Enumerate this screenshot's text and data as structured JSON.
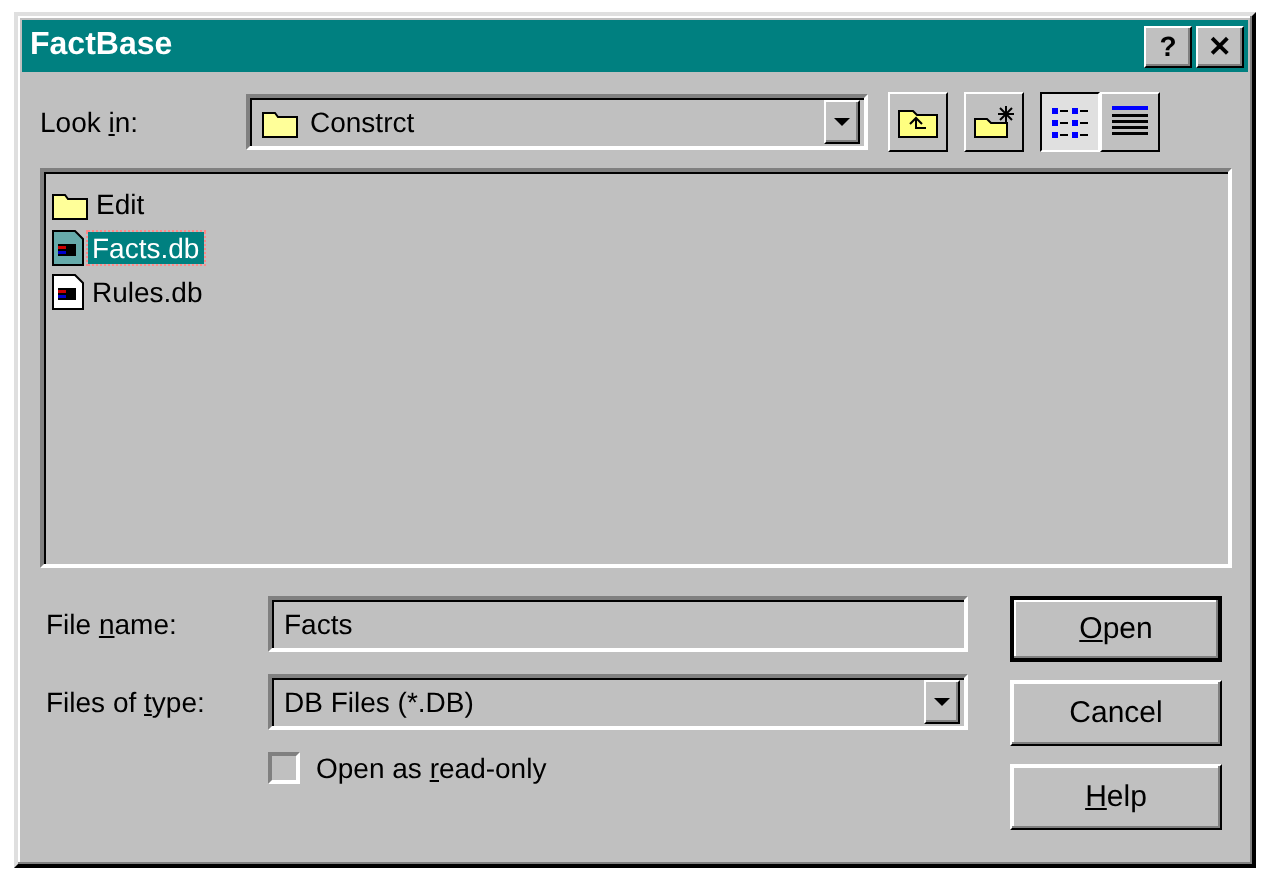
{
  "window": {
    "title": "FactBase",
    "title_buttons": [
      "?",
      "✕"
    ]
  },
  "look_in": {
    "label": {
      "before": "Look ",
      "key": "i",
      "after": "n:"
    },
    "value": "Constrct"
  },
  "toolbar": [
    {
      "kind": "up",
      "selected": false
    },
    {
      "kind": "new",
      "selected": false
    },
    {
      "kind": "list",
      "selected": true
    },
    {
      "kind": "details",
      "selected": false
    }
  ],
  "files": [
    {
      "kind": "folder",
      "name": "Edit",
      "selected": false
    },
    {
      "kind": "db",
      "name": "Facts.db",
      "selected": true
    },
    {
      "kind": "db",
      "name": "Rules.db",
      "selected": false
    }
  ],
  "file_name": {
    "label": {
      "before": "File ",
      "key": "n",
      "after": "ame:"
    },
    "value": "Facts"
  },
  "file_type": {
    "label": {
      "before": "Files of ",
      "key": "t",
      "after": "ype:"
    },
    "value": "DB Files (*.DB)"
  },
  "read_only": {
    "label": {
      "before": "Open as ",
      "key": "r",
      "after": "ead-only"
    },
    "checked": false
  },
  "buttons": [
    {
      "label": {
        "key": "O",
        "after": "pen"
      },
      "default": true
    },
    {
      "label": {
        "before": "Cancel"
      },
      "default": false
    },
    {
      "label": {
        "key": "H",
        "after": "elp"
      },
      "default": false
    }
  ]
}
